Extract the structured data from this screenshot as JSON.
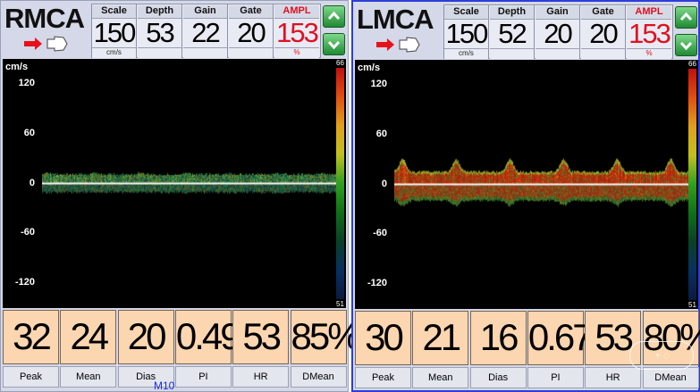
{
  "panels": [
    {
      "vessel": "RMCA",
      "params": [
        {
          "label": "Scale",
          "value": "150",
          "unit": "cm/s"
        },
        {
          "label": "Depth",
          "value": "53",
          "unit": ""
        },
        {
          "label": "Gain",
          "value": "22",
          "unit": ""
        },
        {
          "label": "Gate",
          "value": "20",
          "unit": ""
        },
        {
          "label": "AMPL",
          "value": "153",
          "unit": "%"
        }
      ],
      "axis": {
        "unit": "cm/s",
        "ticks": [
          "120",
          "60",
          "0",
          "-60",
          "-120"
        ],
        "range": [
          -150,
          150
        ]
      },
      "colorbar": {
        "top": "66",
        "bottom": "51"
      },
      "waveform": {
        "peak": 16,
        "base": 11,
        "neg_peak": -13,
        "cycles": 6.5,
        "amplitude": 0.25,
        "intensity": "low"
      },
      "metrics": [
        {
          "label": "Peak",
          "value": "32"
        },
        {
          "label": "Mean",
          "value": "24"
        },
        {
          "label": "Dias",
          "value": "20"
        },
        {
          "label": "PI",
          "value": "0.49"
        },
        {
          "label": "HR",
          "value": "53"
        },
        {
          "label": "DMean",
          "value": "85%"
        }
      ]
    },
    {
      "vessel": "LMCA",
      "params": [
        {
          "label": "Scale",
          "value": "150",
          "unit": "cm/s"
        },
        {
          "label": "Depth",
          "value": "52",
          "unit": ""
        },
        {
          "label": "Gain",
          "value": "20",
          "unit": ""
        },
        {
          "label": "Gate",
          "value": "20",
          "unit": ""
        },
        {
          "label": "AMPL",
          "value": "153",
          "unit": "%"
        }
      ],
      "axis": {
        "unit": "cm/s",
        "ticks": [
          "120",
          "60",
          "0",
          "-60",
          "-120"
        ],
        "range": [
          -150,
          150
        ]
      },
      "colorbar": {
        "top": "66",
        "bottom": "51"
      },
      "waveform": {
        "peak": 30,
        "base": 15,
        "neg_peak": -25,
        "cycles": 5.5,
        "amplitude": 1.0,
        "intensity": "high"
      },
      "metrics": [
        {
          "label": "Peak",
          "value": "30"
        },
        {
          "label": "Mean",
          "value": "21"
        },
        {
          "label": "Dias",
          "value": "16"
        },
        {
          "label": "PI",
          "value": "0.67"
        },
        {
          "label": "HR",
          "value": "53"
        },
        {
          "label": "DMean",
          "value": "80%"
        }
      ]
    }
  ],
  "footer_label": "M10",
  "colors": {
    "probe_arrow": "#e8101a",
    "ampl": "#e01020",
    "metric_bg": "#fcd6b0",
    "active_border": "#2c3ed8",
    "adjust_button": "#2aa340"
  },
  "icons": [
    "probe-icon",
    "arrow-right-icon",
    "chevron-up-icon",
    "chevron-down-icon"
  ]
}
